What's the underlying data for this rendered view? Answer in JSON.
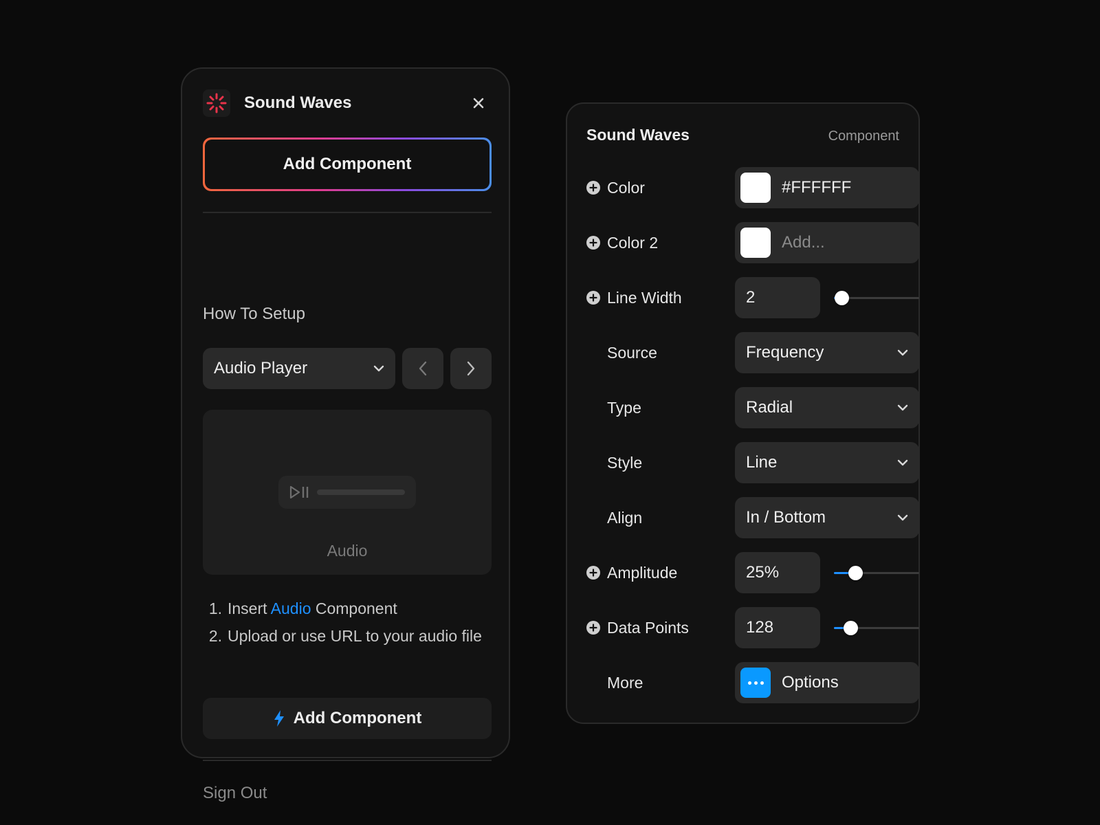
{
  "left_panel": {
    "title": "Sound Waves",
    "add_component_label": "Add Component",
    "how_to_heading": "How To Setup",
    "dropdown_value": "Audio Player",
    "preview_label": "Audio",
    "steps": [
      {
        "number": "1.",
        "before": "Insert ",
        "link": "Audio",
        "after": " Component"
      },
      {
        "number": "2.",
        "text": "Upload or use URL to your audio file"
      }
    ],
    "add_component_secondary_label": "Add Component",
    "sign_out_label": "Sign Out"
  },
  "right_panel": {
    "title": "Sound Waves",
    "subtitle": "Component",
    "color": {
      "label": "Color",
      "value": "#FFFFFF"
    },
    "color2": {
      "label": "Color 2",
      "placeholder": "Add..."
    },
    "line_width": {
      "label": "Line Width",
      "value": "2",
      "slider_fraction": 0.09
    },
    "source": {
      "label": "Source",
      "value": "Frequency"
    },
    "type": {
      "label": "Type",
      "value": "Radial"
    },
    "style": {
      "label": "Style",
      "value": "Line"
    },
    "align": {
      "label": "Align",
      "value": "In / Bottom"
    },
    "amplitude": {
      "label": "Amplitude",
      "value": "25%",
      "slider_fraction": 0.25
    },
    "data_points": {
      "label": "Data Points",
      "value": "128",
      "slider_fraction": 0.19
    },
    "more": {
      "label": "More",
      "button_label": "Options"
    }
  },
  "icons": {
    "logo": "burst-logo-icon",
    "close": "close-icon",
    "chevron": "chevron-down-icon",
    "prev": "chevron-left-icon",
    "next": "chevron-right-icon",
    "play_pause": "play-pause-icon",
    "bolt": "lightning-bolt-icon",
    "plus": "plus-circle-icon",
    "more": "ellipsis-icon"
  },
  "colors": {
    "accent": "#1E90FF",
    "logo_red": "#E8334A",
    "background": "#0B0B0B",
    "panel": "#121212",
    "field": "#2A2A2A"
  }
}
